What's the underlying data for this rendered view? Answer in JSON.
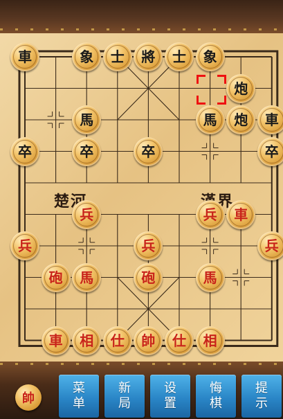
{
  "board": {
    "river_left": "楚河",
    "river_right": "漢界"
  },
  "pieces": [
    {
      "id": "b-chariot-1",
      "char": "車",
      "color": "black",
      "col": 0,
      "row": 0
    },
    {
      "id": "b-elephant-1",
      "char": "象",
      "color": "black",
      "col": 2,
      "row": 0
    },
    {
      "id": "b-advisor-1",
      "char": "士",
      "color": "black",
      "col": 3,
      "row": 0
    },
    {
      "id": "b-general",
      "char": "將",
      "color": "black",
      "col": 4,
      "row": 0
    },
    {
      "id": "b-advisor-2",
      "char": "士",
      "color": "black",
      "col": 5,
      "row": 0
    },
    {
      "id": "b-elephant-2",
      "char": "象",
      "color": "black",
      "col": 6,
      "row": 0
    },
    {
      "id": "b-cannon-1",
      "char": "炮",
      "color": "black",
      "col": 7,
      "row": 1
    },
    {
      "id": "b-horse-1",
      "char": "馬",
      "color": "black",
      "col": 2,
      "row": 2
    },
    {
      "id": "b-horse-2",
      "char": "馬",
      "color": "black",
      "col": 6,
      "row": 2
    },
    {
      "id": "b-cannon-2",
      "char": "炮",
      "color": "black",
      "col": 7,
      "row": 2
    },
    {
      "id": "b-chariot-2",
      "char": "車",
      "color": "black",
      "col": 8,
      "row": 2
    },
    {
      "id": "b-soldier-1",
      "char": "卒",
      "color": "black",
      "col": 0,
      "row": 3
    },
    {
      "id": "b-soldier-2",
      "char": "卒",
      "color": "black",
      "col": 2,
      "row": 3
    },
    {
      "id": "b-soldier-3",
      "char": "卒",
      "color": "black",
      "col": 4,
      "row": 3
    },
    {
      "id": "b-soldier-4",
      "char": "卒",
      "color": "black",
      "col": 8,
      "row": 3
    },
    {
      "id": "r-soldier-1",
      "char": "兵",
      "color": "red",
      "col": 2,
      "row": 5
    },
    {
      "id": "r-soldier-2",
      "char": "兵",
      "color": "red",
      "col": 6,
      "row": 5
    },
    {
      "id": "r-chariot-1",
      "char": "車",
      "color": "red",
      "col": 7,
      "row": 5
    },
    {
      "id": "r-soldier-3",
      "char": "兵",
      "color": "red",
      "col": 0,
      "row": 6
    },
    {
      "id": "r-soldier-4",
      "char": "兵",
      "color": "red",
      "col": 4,
      "row": 6
    },
    {
      "id": "r-soldier-5",
      "char": "兵",
      "color": "red",
      "col": 8,
      "row": 6
    },
    {
      "id": "r-cannon-1",
      "char": "砲",
      "color": "red",
      "col": 1,
      "row": 7
    },
    {
      "id": "r-horse-1",
      "char": "馬",
      "color": "red",
      "col": 2,
      "row": 7
    },
    {
      "id": "r-cannon-2",
      "char": "砲",
      "color": "red",
      "col": 4,
      "row": 7
    },
    {
      "id": "r-horse-2",
      "char": "馬",
      "color": "red",
      "col": 6,
      "row": 7
    },
    {
      "id": "r-chariot-2",
      "char": "車",
      "color": "red",
      "col": 1,
      "row": 9
    },
    {
      "id": "r-minister-1",
      "char": "相",
      "color": "red",
      "col": 2,
      "row": 9
    },
    {
      "id": "r-advisor-1",
      "char": "仕",
      "color": "red",
      "col": 3,
      "row": 9
    },
    {
      "id": "r-marshal",
      "char": "帥",
      "color": "red",
      "col": 4,
      "row": 9
    },
    {
      "id": "r-advisor-2",
      "char": "仕",
      "color": "red",
      "col": 5,
      "row": 9
    },
    {
      "id": "r-minister-2",
      "char": "相",
      "color": "red",
      "col": 6,
      "row": 9
    }
  ],
  "selection": {
    "col": 6,
    "row": 1
  },
  "toolbar": {
    "turn_indicator": "帥",
    "buttons": [
      {
        "name": "menu-button",
        "line1": "菜",
        "line2": "单"
      },
      {
        "name": "new-game-button",
        "line1": "新",
        "line2": "局"
      },
      {
        "name": "settings-button",
        "line1": "设",
        "line2": "置"
      },
      {
        "name": "undo-button",
        "line1": "悔",
        "line2": "棋"
      },
      {
        "name": "hint-button",
        "line1": "提",
        "line2": "示"
      }
    ]
  },
  "colors": {
    "black_text": "#1a1a1a",
    "red_text": "#c8231a",
    "selection": "#e11111",
    "button": "#2a86c7"
  }
}
